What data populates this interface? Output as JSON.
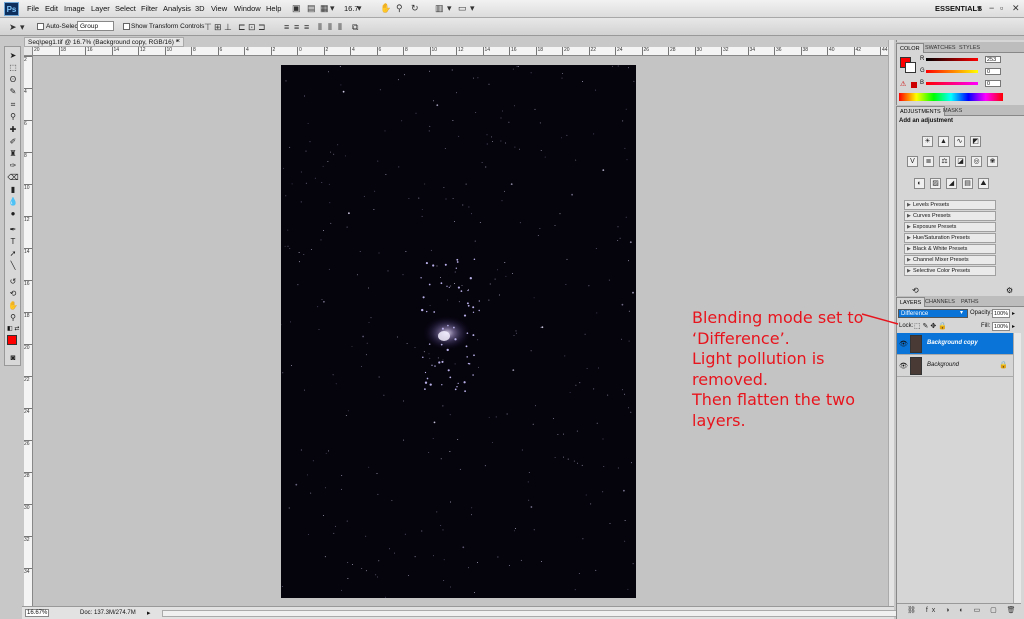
{
  "menubar": {
    "logo": "Ps",
    "items": [
      "File",
      "Edit",
      "Image",
      "Layer",
      "Select",
      "Filter",
      "Analysis",
      "3D",
      "View",
      "Window",
      "Help"
    ],
    "zoom": "16.7",
    "workspace": "ESSENTIALS"
  },
  "options": {
    "auto_select_label": "Auto-Select:",
    "auto_select_value": "Group",
    "transform_label": "Show Transform Controls"
  },
  "document": {
    "tab_title": "Seq\\peg1.tif @ 16.7% (Background copy, RGB/16) *",
    "ruler_top": [
      "20",
      "18",
      "16",
      "14",
      "12",
      "10",
      "8",
      "6",
      "4",
      "2",
      "0",
      "2",
      "4",
      "6",
      "8",
      "10",
      "12",
      "14",
      "16",
      "18",
      "20",
      "22",
      "24",
      "26",
      "28",
      "30",
      "32",
      "34",
      "36",
      "38",
      "40",
      "42",
      "44"
    ],
    "ruler_left": [
      "2",
      "4",
      "6",
      "8",
      "10",
      "12",
      "14",
      "16",
      "18",
      "20",
      "22",
      "24",
      "26",
      "28",
      "30",
      "32",
      "34"
    ]
  },
  "status": {
    "zoom": "16.67%",
    "doc": "Doc: 137.3M/274.7M"
  },
  "color_panel": {
    "tabs": [
      "COLOR",
      "SWATCHES",
      "STYLES"
    ],
    "r_label": "R",
    "g_label": "G",
    "b_label": "B",
    "r_value": "253",
    "g_value": "0",
    "b_value": "0",
    "foreground_color": "#ff0000"
  },
  "adjustments_panel": {
    "tabs": [
      "ADJUSTMENTS",
      "MASKS"
    ],
    "heading": "Add an adjustment",
    "presets": [
      "Levels Presets",
      "Curves Presets",
      "Exposure Presets",
      "Hue/Saturation Presets",
      "Black & White Presets",
      "Channel Mixer Presets",
      "Selective Color Presets"
    ]
  },
  "layers_panel": {
    "tabs": [
      "LAYERS",
      "CHANNELS",
      "PATHS"
    ],
    "blend_mode": "Difference",
    "opacity_label": "Opacity:",
    "opacity_value": "100%",
    "lock_label": "Lock:",
    "fill_label": "Fill:",
    "fill_value": "100%",
    "layers": [
      {
        "name": "Background copy",
        "selected": true
      },
      {
        "name": "Background",
        "selected": false
      }
    ],
    "highlight_color": "#0a74d8"
  },
  "annotation": {
    "lines": [
      "Blending mode set to",
      "‘Difference’.",
      "Light pollution is",
      "removed.",
      "Then flatten the two",
      "layers."
    ],
    "color": "#e8141d"
  }
}
